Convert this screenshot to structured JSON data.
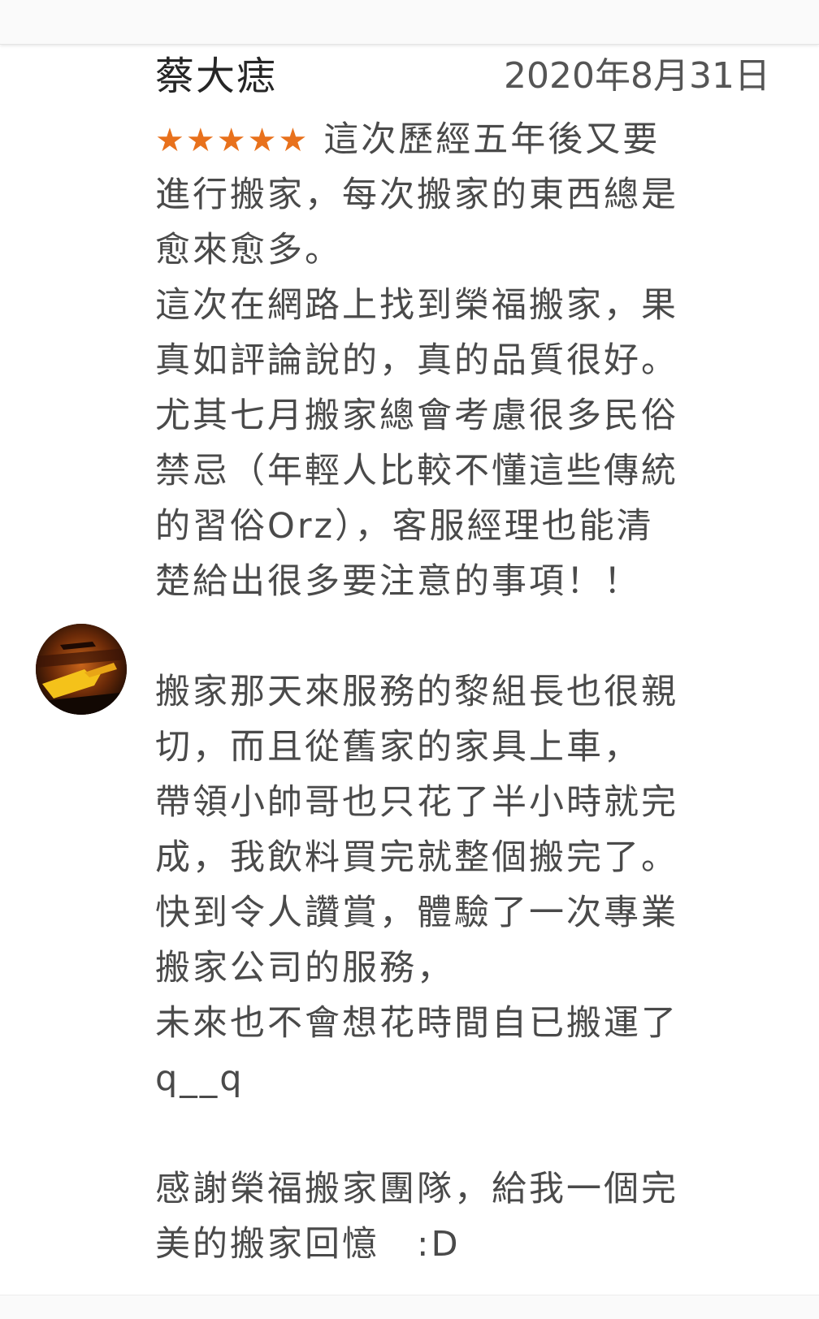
{
  "top": {
    "cutoff_text": "⋯ ⋯ ⋯"
  },
  "review": {
    "reviewer_name": "蔡大痣",
    "date": "2020年8月31日",
    "rating": 5,
    "stars": "★★★★★",
    "lines": [
      "這次歷經五年後又要",
      "進行搬家，每次搬家的東西總是",
      "愈來愈多。",
      "這次在網路上找到榮福搬家，果",
      "真如評論說的，真的品質很好。",
      "尤其七月搬家總會考慮很多民俗",
      "禁忌（年輕人比較不懂這些傳統",
      "的習俗Orz），客服經理也能清",
      "楚給出很多要注意的事項！！",
      "",
      "搬家那天來服務的黎組長也很親",
      "切，而且從舊家的家具上車，",
      "帶領小帥哥也只花了半小時就完",
      "成，我飲料買完就整個搬完了。",
      "快到令人讚賞，體驗了一次專業",
      "搬家公司的服務，",
      "未來也不會想花時間自已搬運了",
      " q__q",
      "",
      "感謝榮福搬家團隊，給我一個完",
      "美的搬家回憶　:D"
    ]
  },
  "colors": {
    "star": "#e8711c",
    "text": "#4a4a4a",
    "name": "#262626"
  }
}
